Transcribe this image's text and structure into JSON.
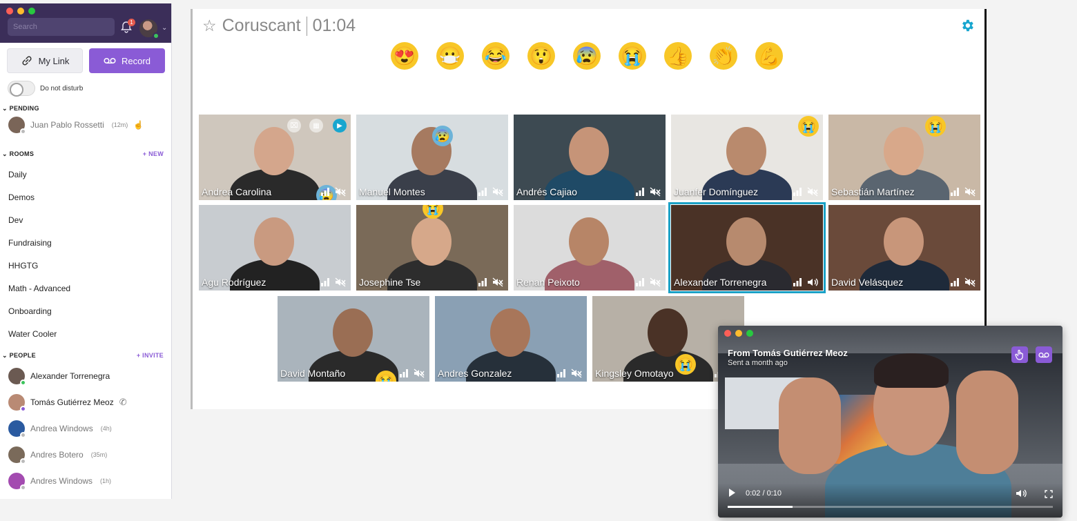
{
  "sidebar": {
    "search_placeholder": "Search",
    "notification_count": "1",
    "my_link_label": "My Link",
    "record_label": "Record",
    "dnd_label": "Do not disturb",
    "pending": {
      "title": "PENDING",
      "items": [
        {
          "name": "Juan Pablo Rossetti",
          "meta": "(12m)"
        }
      ]
    },
    "rooms": {
      "title": "ROOMS",
      "action": "+ NEW",
      "items": [
        "Daily",
        "Demos",
        "Dev",
        "Fundraising",
        "HHGTG",
        "Math - Advanced",
        "Onboarding",
        "Water Cooler"
      ]
    },
    "people": {
      "title": "PEOPLE",
      "action": "+ INVITE",
      "items": [
        {
          "name": "Alexander Torrenegra",
          "meta": "",
          "status_color": "#3cc35c",
          "avatar_color": "#6b5a52",
          "muted": false
        },
        {
          "name": "Tomás Gutiérrez Meoz",
          "meta": "",
          "status_color": "#8a5bd6",
          "avatar_color": "#b98a74",
          "muted": false
        },
        {
          "name": "Andrea Windows",
          "meta": "(4h)",
          "status_color": "#bbbbbb",
          "avatar_color": "#2a5aa0",
          "muted": true
        },
        {
          "name": "Andres Botero",
          "meta": "(35m)",
          "status_color": "#bbbbbb",
          "avatar_color": "#7a6a5a",
          "muted": true
        },
        {
          "name": "Andres Windows",
          "meta": "(1h)",
          "status_color": "#bbbbbb",
          "avatar_color": "#a34bb0",
          "muted": true
        }
      ]
    }
  },
  "call": {
    "room_name": "Coruscant",
    "timer": "01:04",
    "reactions": [
      {
        "name": "heart-eyes",
        "glyph": "😍"
      },
      {
        "name": "face-with-mask",
        "glyph": "😷"
      },
      {
        "name": "tears-of-joy",
        "glyph": "😂"
      },
      {
        "name": "astonished",
        "glyph": "😲"
      },
      {
        "name": "cold-face",
        "glyph": "😰"
      },
      {
        "name": "crying",
        "glyph": "😭"
      },
      {
        "name": "thumbs-up",
        "glyph": "👍"
      },
      {
        "name": "clapping",
        "glyph": "👏"
      },
      {
        "name": "flexed-biceps",
        "glyph": "💪"
      }
    ],
    "participants": [
      {
        "name": "Andrea Carolina",
        "bg": "#cfc7bd",
        "skin": "#d4a68c",
        "shirt": "#2a2a2a",
        "unmuted": false
      },
      {
        "name": "Manuel Montes",
        "bg": "#d7dde0",
        "skin": "#a67a60",
        "shirt": "#3a3f4a",
        "unmuted": false
      },
      {
        "name": "Andrés Cajiao",
        "bg": "#3d4a52",
        "skin": "#c69478",
        "shirt": "#1f4a66",
        "unmuted": false
      },
      {
        "name": "Juanfer Domínguez",
        "bg": "#e8e6e2",
        "skin": "#b98a6d",
        "shirt": "#2b3a55",
        "unmuted": false
      },
      {
        "name": "Sebastián Martínez",
        "bg": "#c9b8a6",
        "skin": "#d8a88a",
        "shirt": "#5a6570",
        "unmuted": false
      },
      {
        "name": "Agu Rodríguez",
        "bg": "#c8ccd0",
        "skin": "#c99a80",
        "shirt": "#222222",
        "unmuted": false
      },
      {
        "name": "Josephine Tse",
        "bg": "#7a6a58",
        "skin": "#d6a88a",
        "shirt": "#2d2d2d",
        "unmuted": false
      },
      {
        "name": "Renan Peixoto",
        "bg": "#dcdcdc",
        "skin": "#b78567",
        "shirt": "#a0606a",
        "unmuted": false
      },
      {
        "name": "Alexander Torrenegra",
        "bg": "#4a3226",
        "skin": "#b78a6e",
        "shirt": "#2a2a30",
        "unmuted": true
      },
      {
        "name": "David Velásquez",
        "bg": "#6a4a3a",
        "skin": "#c8967a",
        "shirt": "#1e2a3a",
        "unmuted": false
      },
      {
        "name": "David Montaño",
        "bg": "#aab4bc",
        "skin": "#9a6e54",
        "shirt": "#2a2a2a",
        "unmuted": false
      },
      {
        "name": "Andres Gonzalez",
        "bg": "#8aa0b4",
        "skin": "#a8765a",
        "shirt": "#26303a",
        "unmuted": false
      },
      {
        "name": "Kingsley Omotayo",
        "bg": "#b7b0a6",
        "skin": "#4a3226",
        "shirt": "#2a2a2a",
        "unmuted": false
      }
    ]
  },
  "player": {
    "from": "From Tomás Gutiérrez Meoz",
    "sent": "Sent a month ago",
    "time": "0:02 / 0:10",
    "progress": 0.2
  },
  "colors": {
    "accent": "#8a5bd6",
    "selected": "#1aa1c6",
    "sidebar_header": "#3b2e59"
  }
}
